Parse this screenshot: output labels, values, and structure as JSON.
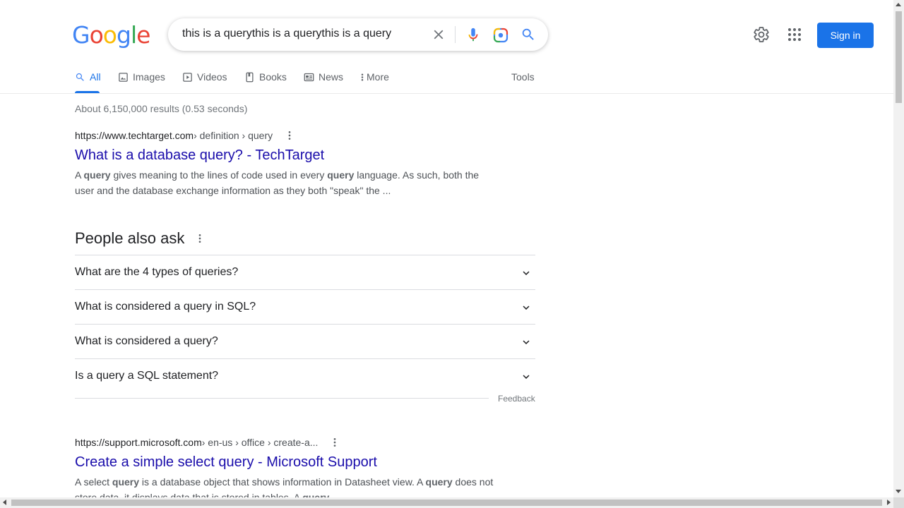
{
  "logo": {
    "letters": [
      "G",
      "o",
      "o",
      "g",
      "l",
      "e"
    ],
    "colors": [
      "#4285F4",
      "#EA4335",
      "#FBBC05",
      "#4285F4",
      "#34A853",
      "#EA4335"
    ]
  },
  "search": {
    "query": "this is a querythis is a querythis is a query"
  },
  "header": {
    "signin_label": "Sign in"
  },
  "tabs": [
    {
      "label": "All",
      "icon": "search-icon"
    },
    {
      "label": "Images",
      "icon": "image-icon"
    },
    {
      "label": "Videos",
      "icon": "video-icon"
    },
    {
      "label": "Books",
      "icon": "book-icon"
    },
    {
      "label": "News",
      "icon": "news-icon"
    },
    {
      "label": "More",
      "icon": "more-vert-icon"
    }
  ],
  "tools_label": "Tools",
  "stats": "About 6,150,000 results (0.53 seconds)",
  "results": [
    {
      "domain": "https://www.techtarget.com",
      "path": " › definition › query",
      "title": "What is a database query? - TechTarget",
      "snippet": [
        {
          "t": "A "
        },
        {
          "t": "query",
          "b": true
        },
        {
          "t": " gives meaning to the lines of code used in every "
        },
        {
          "t": "query",
          "b": true
        },
        {
          "t": " language. As such, both the user and the database exchange information as they both \"speak\" the ..."
        }
      ]
    },
    {
      "domain": "https://support.microsoft.com",
      "path": " › en-us › office › create-a...",
      "title": "Create a simple select query - Microsoft Support",
      "snippet": [
        {
          "t": "A select "
        },
        {
          "t": "query",
          "b": true
        },
        {
          "t": " is a database object that shows information in Datasheet view. A "
        },
        {
          "t": "query",
          "b": true
        },
        {
          "t": " does not store data, it displays data that is stored in tables. A "
        },
        {
          "t": "query",
          "b": true
        }
      ]
    }
  ],
  "paa": {
    "heading": "People also ask",
    "questions": [
      "What are the 4 types of queries?",
      "What is considered a query in SQL?",
      "What is considered a query?",
      "Is a query a SQL statement?"
    ],
    "feedback": "Feedback"
  },
  "colors": {
    "accent": "#1a73e8",
    "link": "#1a0dab"
  }
}
